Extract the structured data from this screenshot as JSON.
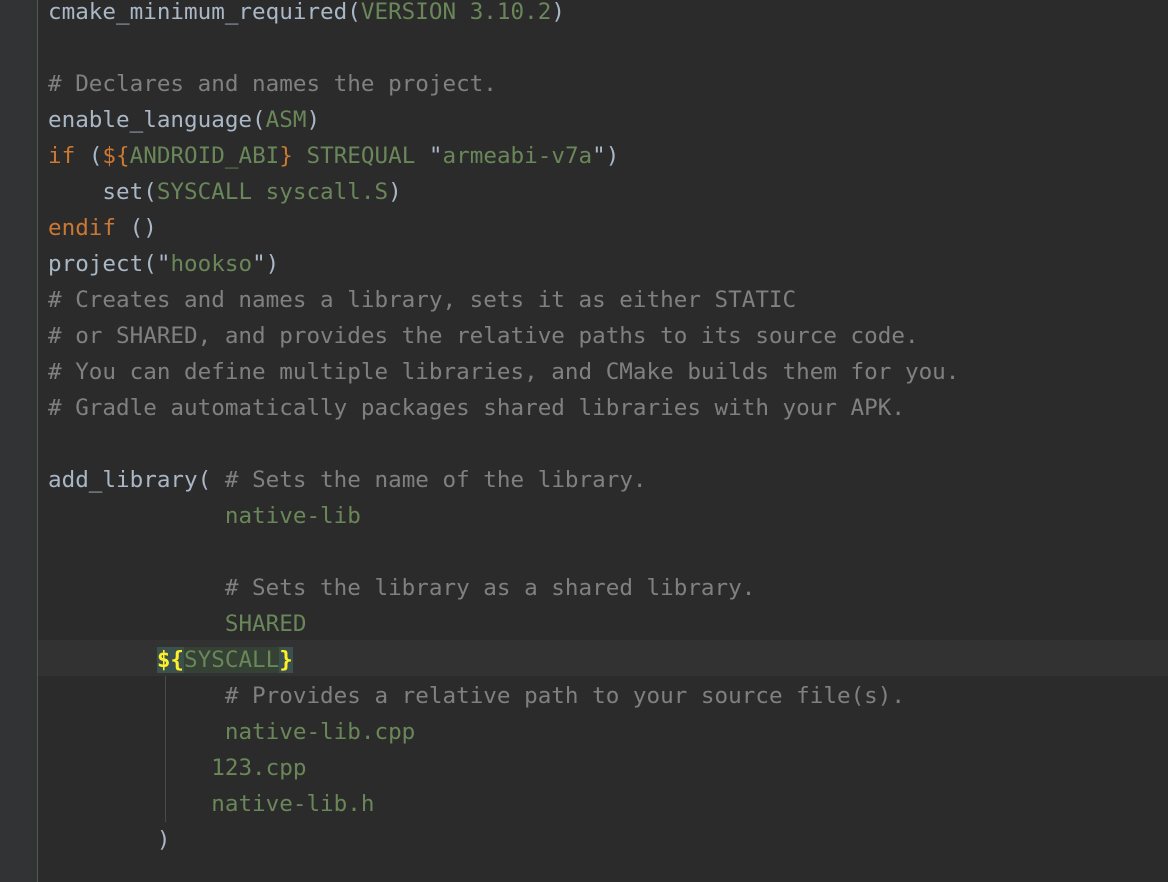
{
  "lines": [
    {
      "segments": [
        {
          "text": "cmake_minimum_required",
          "cls": "fn"
        },
        {
          "text": "(",
          "cls": "fn"
        },
        {
          "text": "VERSION 3.10.2",
          "cls": "arg"
        },
        {
          "text": ")",
          "cls": "fn"
        }
      ]
    },
    {
      "segments": []
    },
    {
      "segments": [
        {
          "text": "# Declares and names the project.",
          "cls": "cm"
        }
      ]
    },
    {
      "segments": [
        {
          "text": "enable_language",
          "cls": "fn"
        },
        {
          "text": "(",
          "cls": "fn"
        },
        {
          "text": "ASM",
          "cls": "arg"
        },
        {
          "text": ")",
          "cls": "fn"
        }
      ]
    },
    {
      "segments": [
        {
          "text": "if ",
          "cls": "kw"
        },
        {
          "text": "(",
          "cls": "fn"
        },
        {
          "text": "${",
          "cls": "kw"
        },
        {
          "text": "ANDROID_ABI",
          "cls": "arg"
        },
        {
          "text": "}",
          "cls": "kw"
        },
        {
          "text": " STREQUAL ",
          "cls": "arg"
        },
        {
          "text": "\"",
          "cls": "fn"
        },
        {
          "text": "armeabi-v7a",
          "cls": "str"
        },
        {
          "text": "\"",
          "cls": "fn"
        },
        {
          "text": ")",
          "cls": "fn"
        }
      ]
    },
    {
      "segments": [
        {
          "text": "    set",
          "cls": "fn"
        },
        {
          "text": "(",
          "cls": "fn"
        },
        {
          "text": "SYSCALL syscall.S",
          "cls": "arg"
        },
        {
          "text": ")",
          "cls": "fn"
        }
      ]
    },
    {
      "segments": [
        {
          "text": "endif",
          "cls": "kw"
        },
        {
          "text": " ()",
          "cls": "fn"
        }
      ]
    },
    {
      "segments": [
        {
          "text": "project",
          "cls": "fn"
        },
        {
          "text": "(\"",
          "cls": "fn"
        },
        {
          "text": "hookso",
          "cls": "str"
        },
        {
          "text": "\")",
          "cls": "fn"
        }
      ]
    },
    {
      "segments": [
        {
          "text": "# Creates and names a library, sets it as either STATIC",
          "cls": "cm"
        }
      ]
    },
    {
      "segments": [
        {
          "text": "# or SHARED, and provides the relative paths to its source code.",
          "cls": "cm"
        }
      ]
    },
    {
      "segments": [
        {
          "text": "# You can define multiple libraries, and CMake builds them for you.",
          "cls": "cm"
        }
      ]
    },
    {
      "segments": [
        {
          "text": "# Gradle automatically packages shared libraries with your APK.",
          "cls": "cm"
        }
      ]
    },
    {
      "segments": []
    },
    {
      "segments": [
        {
          "text": "add_library",
          "cls": "fn"
        },
        {
          "text": "( ",
          "cls": "fn"
        },
        {
          "text": "# Sets the name of the library.",
          "cls": "cm"
        }
      ]
    },
    {
      "segments": [
        {
          "text": "             ",
          "cls": "fn"
        },
        {
          "text": "native-lib",
          "cls": "arg"
        }
      ]
    },
    {
      "segments": []
    },
    {
      "segments": [
        {
          "text": "             ",
          "cls": "fn"
        },
        {
          "text": "# Sets the library as a shared library.",
          "cls": "cm"
        }
      ]
    },
    {
      "segments": [
        {
          "text": "             ",
          "cls": "fn"
        },
        {
          "text": "SHARED",
          "cls": "arg"
        }
      ]
    },
    {
      "segments": [
        {
          "text": "        ",
          "cls": "fn"
        },
        {
          "text": "${",
          "cls": "brace-hl"
        },
        {
          "text": "SYSCALL",
          "cls": "var-hl"
        },
        {
          "text": "}",
          "cls": "brace-hl"
        }
      ]
    },
    {
      "segments": [
        {
          "text": "             ",
          "cls": "fn"
        },
        {
          "text": "# Provides a relative path to your source file(s).",
          "cls": "cm"
        }
      ]
    },
    {
      "segments": [
        {
          "text": "             ",
          "cls": "fn"
        },
        {
          "text": "native-lib.cpp",
          "cls": "arg"
        }
      ]
    },
    {
      "segments": [
        {
          "text": "            ",
          "cls": "fn"
        },
        {
          "text": "123.cpp",
          "cls": "arg"
        }
      ]
    },
    {
      "segments": [
        {
          "text": "            ",
          "cls": "fn"
        },
        {
          "text": "native-lib.h",
          "cls": "arg"
        }
      ]
    },
    {
      "segments": [
        {
          "text": "        )",
          "cls": "fn"
        }
      ]
    }
  ]
}
